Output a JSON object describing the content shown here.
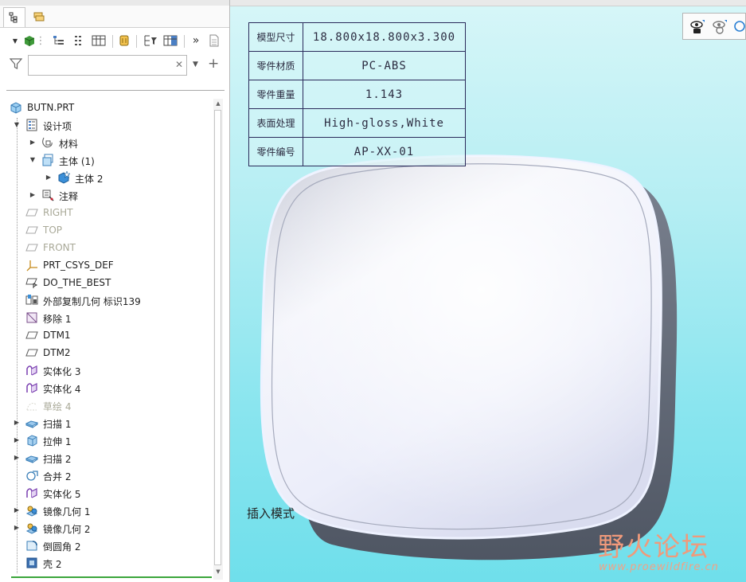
{
  "search": {
    "placeholder": "",
    "value": ""
  },
  "model_tree": {
    "items": [
      {
        "label": "BUTN.PRT",
        "icon": "part-icon",
        "level": 0,
        "expand": "none",
        "style": "normal"
      },
      {
        "label": "设计项",
        "icon": "design-items-icon",
        "level": 1,
        "expand": "expanded",
        "style": "normal"
      },
      {
        "label": "材料",
        "icon": "material-icon",
        "level": 2,
        "expand": "collapsed",
        "style": "normal"
      },
      {
        "label": "主体 (1)",
        "icon": "body-icon",
        "level": 2,
        "expand": "expanded",
        "style": "normal"
      },
      {
        "label": "主体 2",
        "icon": "body-star-icon",
        "level": 3,
        "expand": "collapsed",
        "style": "normal"
      },
      {
        "label": "注释",
        "icon": "annotation-icon",
        "level": 2,
        "expand": "collapsed",
        "style": "normal"
      },
      {
        "label": "RIGHT",
        "icon": "datum-plane-icon",
        "level": 1,
        "expand": "none",
        "style": "dim"
      },
      {
        "label": "TOP",
        "icon": "datum-plane-icon",
        "level": 1,
        "expand": "none",
        "style": "dim"
      },
      {
        "label": "FRONT",
        "icon": "datum-plane-icon",
        "level": 1,
        "expand": "none",
        "style": "dim"
      },
      {
        "label": "PRT_CSYS_DEF",
        "icon": "csys-icon",
        "level": 1,
        "expand": "none",
        "style": "normal"
      },
      {
        "label": "DO_THE_BEST",
        "icon": "datum-plane-flag-icon",
        "level": 1,
        "expand": "none",
        "style": "normal"
      },
      {
        "label": "外部复制几何 标识139",
        "icon": "external-copy-geometry-icon",
        "level": 1,
        "expand": "none",
        "style": "normal"
      },
      {
        "label": "移除 1",
        "icon": "remove-icon",
        "level": 1,
        "expand": "none",
        "style": "normal"
      },
      {
        "label": "DTM1",
        "icon": "datum-plane-icon",
        "level": 1,
        "expand": "none",
        "style": "normal"
      },
      {
        "label": "DTM2",
        "icon": "datum-plane-icon",
        "level": 1,
        "expand": "none",
        "style": "normal"
      },
      {
        "label": "实体化 3",
        "icon": "solidify-icon",
        "level": 1,
        "expand": "none",
        "style": "normal"
      },
      {
        "label": "实体化 4",
        "icon": "solidify-icon",
        "level": 1,
        "expand": "none",
        "style": "normal"
      },
      {
        "label": "草绘 4",
        "icon": "sketch-icon",
        "level": 1,
        "expand": "none",
        "style": "dim"
      },
      {
        "label": "扫描 1",
        "icon": "sweep-icon",
        "level": 1,
        "expand": "collapsed",
        "style": "normal"
      },
      {
        "label": "拉伸 1",
        "icon": "extrude-icon",
        "level": 1,
        "expand": "collapsed",
        "style": "normal"
      },
      {
        "label": "扫描 2",
        "icon": "sweep-icon",
        "level": 1,
        "expand": "collapsed",
        "style": "normal"
      },
      {
        "label": "合并 2",
        "icon": "merge-icon",
        "level": 1,
        "expand": "none",
        "style": "normal"
      },
      {
        "label": "实体化 5",
        "icon": "solidify-icon",
        "level": 1,
        "expand": "none",
        "style": "normal"
      },
      {
        "label": "镜像几何 1",
        "icon": "mirror-geometry-icon",
        "level": 1,
        "expand": "collapsed",
        "style": "normal"
      },
      {
        "label": "镜像几何 2",
        "icon": "mirror-geometry-icon",
        "level": 1,
        "expand": "collapsed",
        "style": "normal"
      },
      {
        "label": "倒圆角 2",
        "icon": "round-icon",
        "level": 1,
        "expand": "none",
        "style": "normal"
      },
      {
        "label": "壳 2",
        "icon": "shell-icon",
        "level": 1,
        "expand": "none",
        "style": "normal"
      }
    ]
  },
  "info_table": [
    {
      "key": "模型尺寸",
      "value": "18.800x18.800x3.300"
    },
    {
      "key": "零件材质",
      "value": "PC-ABS"
    },
    {
      "key": "零件重量",
      "value": "1.143"
    },
    {
      "key": "表面处理",
      "value": "High-gloss,White"
    },
    {
      "key": "零件编号",
      "value": "AP-XX-01"
    }
  ],
  "viewport": {
    "mode_text": "插入模式"
  },
  "watermark": {
    "main": "野火论坛",
    "sub": "www.proewildfire.cn"
  },
  "colors": {
    "viewport_top": "#d7f6f8",
    "viewport_bottom": "#6fdfeb",
    "part_face": "#eef0fb",
    "part_side": "#5c6471",
    "table_border": "#2a2a5a",
    "watermark": "#f09a7b",
    "insert_marker": "#3aa53a"
  }
}
